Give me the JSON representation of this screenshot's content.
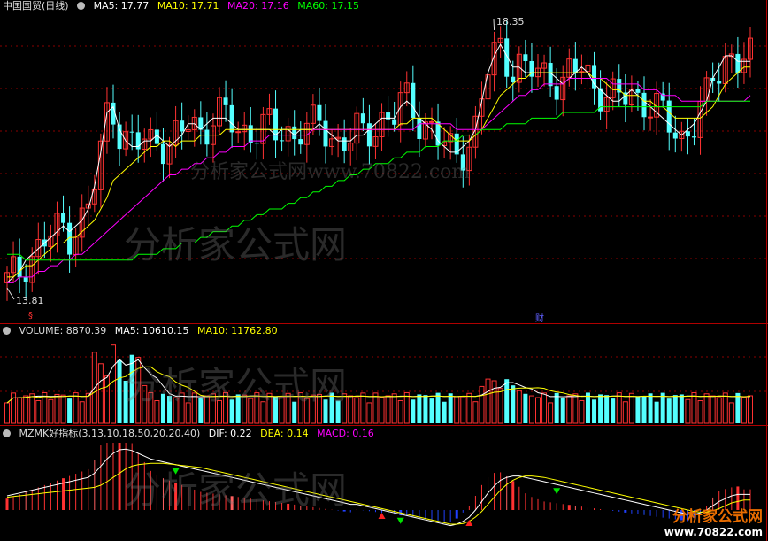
{
  "header": {
    "title": "中国国贸(日线)",
    "ma5": "MA5: 17.77",
    "ma10": "MA10: 17.71",
    "ma20": "MA20: 17.16",
    "ma60": "MA60: 17.15"
  },
  "volume_header": {
    "label": "VOLUME: 8870.39",
    "ma5": "MA5: 10610.15",
    "ma10": "MA10: 11762.80"
  },
  "indicator_header": {
    "label": "MZMK好指标(3,13,10,18,50,20,20,40)",
    "dif": "DIF: 0.22",
    "dea": "DEA: 0.14",
    "macd": "MACD: 0.16"
  },
  "annotations": {
    "high": "18.35",
    "low": "13.81",
    "caibadge": "财"
  },
  "watermark": {
    "main": "分析家公式网",
    "url": "分析家公式网www.70822.com"
  },
  "logo": {
    "title": "分析家公式网",
    "url": "www.70822.com"
  },
  "colors": {
    "up": "#ff3232",
    "down": "#54ffff",
    "ma5": "#ffffff",
    "ma10": "#ffff00",
    "ma20": "#ff00ff",
    "ma60": "#00ff00",
    "frame": "#b00000",
    "histogram_neg": "#2040ff"
  },
  "chart_data": [
    {
      "type": "candlestick",
      "panel": "price",
      "ylim": [
        13.5,
        18.6
      ],
      "series": [
        {
          "name": "MA5",
          "values": [
            13.9,
            14.0,
            14.1,
            14.3,
            14.4,
            14.5,
            14.6,
            14.7,
            14.8,
            14.9,
            14.8,
            14.9,
            15.0,
            15.2,
            15.6,
            16.2,
            16.9,
            17.0,
            16.6,
            16.4,
            16.3,
            16.3,
            16.4,
            16.4,
            16.5,
            16.4,
            16.3,
            16.4,
            16.5,
            16.7,
            16.7,
            16.6,
            16.7,
            16.8,
            16.8,
            16.8,
            16.7,
            16.6,
            16.6,
            16.6,
            16.6,
            16.6,
            16.6,
            16.5,
            16.6,
            16.6,
            16.5,
            16.6,
            16.6,
            16.6,
            16.7,
            16.6,
            16.5,
            16.4,
            16.4,
            16.4,
            16.5,
            16.5,
            16.6,
            16.7,
            16.8,
            16.8,
            16.8,
            17.0,
            17.1,
            17.0,
            16.8,
            16.7,
            16.6,
            16.4,
            16.3,
            16.2,
            16.2,
            16.3,
            16.4,
            16.6,
            17.1,
            17.6,
            17.9,
            18.1,
            17.9,
            17.7,
            17.7,
            17.6,
            17.6,
            17.6,
            17.6,
            17.6,
            17.5,
            17.4,
            17.5,
            17.6,
            17.7,
            17.6,
            17.4,
            17.3,
            17.2,
            17.1,
            17.1,
            17.2,
            17.3,
            17.2,
            17.1,
            17.0,
            16.9,
            16.8,
            16.7,
            16.6,
            16.5,
            16.6,
            16.7,
            16.9,
            17.1,
            17.5,
            17.7,
            17.9,
            17.9,
            17.8,
            17.8,
            17.8
          ]
        },
        {
          "name": "MA10",
          "values": [
            14.0,
            14.0,
            14.1,
            14.2,
            14.2,
            14.3,
            14.4,
            14.5,
            14.6,
            14.6,
            14.7,
            14.7,
            14.8,
            14.9,
            15.0,
            15.2,
            15.4,
            15.7,
            15.8,
            15.9,
            16.0,
            16.1,
            16.2,
            16.3,
            16.3,
            16.4,
            16.4,
            16.3,
            16.4,
            16.4,
            16.4,
            16.5,
            16.5,
            16.5,
            16.5,
            16.6,
            16.6,
            16.6,
            16.6,
            16.6,
            16.6,
            16.6,
            16.6,
            16.6,
            16.6,
            16.6,
            16.6,
            16.6,
            16.6,
            16.6,
            16.6,
            16.6,
            16.6,
            16.6,
            16.6,
            16.6,
            16.6,
            16.6,
            16.6,
            16.6,
            16.6,
            16.6,
            16.6,
            16.7,
            16.7,
            16.8,
            16.8,
            16.8,
            16.8,
            16.7,
            16.6,
            16.5,
            16.4,
            16.4,
            16.4,
            16.5,
            16.6,
            16.8,
            17.0,
            17.2,
            17.3,
            17.4,
            17.5,
            17.5,
            17.6,
            17.6,
            17.6,
            17.6,
            17.6,
            17.6,
            17.6,
            17.6,
            17.6,
            17.6,
            17.5,
            17.5,
            17.4,
            17.3,
            17.3,
            17.2,
            17.2,
            17.2,
            17.1,
            17.1,
            17.0,
            17.0,
            16.9,
            16.8,
            16.8,
            16.8,
            16.8,
            16.8,
            16.9,
            17.0,
            17.2,
            17.4,
            17.5,
            17.6,
            17.7,
            17.7
          ]
        },
        {
          "name": "MA20",
          "values": [
            13.9,
            13.9,
            14.0,
            14.0,
            14.0,
            14.1,
            14.1,
            14.2,
            14.2,
            14.3,
            14.3,
            14.4,
            14.4,
            14.5,
            14.6,
            14.7,
            14.8,
            14.9,
            15.0,
            15.1,
            15.2,
            15.3,
            15.4,
            15.5,
            15.6,
            15.7,
            15.8,
            15.8,
            15.9,
            15.9,
            16.0,
            16.0,
            16.1,
            16.1,
            16.2,
            16.2,
            16.3,
            16.3,
            16.3,
            16.4,
            16.4,
            16.4,
            16.5,
            16.5,
            16.5,
            16.5,
            16.5,
            16.5,
            16.5,
            16.6,
            16.6,
            16.6,
            16.6,
            16.6,
            16.6,
            16.6,
            16.6,
            16.6,
            16.6,
            16.6,
            16.6,
            16.6,
            16.6,
            16.6,
            16.6,
            16.6,
            16.7,
            16.7,
            16.7,
            16.7,
            16.7,
            16.7,
            16.6,
            16.6,
            16.6,
            16.6,
            16.6,
            16.7,
            16.8,
            16.9,
            17.0,
            17.1,
            17.2,
            17.2,
            17.3,
            17.3,
            17.4,
            17.4,
            17.4,
            17.4,
            17.5,
            17.5,
            17.5,
            17.5,
            17.5,
            17.5,
            17.5,
            17.4,
            17.4,
            17.4,
            17.4,
            17.4,
            17.3,
            17.3,
            17.3,
            17.2,
            17.2,
            17.2,
            17.1,
            17.1,
            17.1,
            17.1,
            17.1,
            17.1,
            17.1,
            17.1,
            17.1,
            17.1,
            17.1,
            17.2
          ]
        },
        {
          "name": "MA60",
          "values": [
            14.4,
            14.4,
            14.4,
            14.3,
            14.3,
            14.3,
            14.3,
            14.3,
            14.3,
            14.3,
            14.3,
            14.3,
            14.3,
            14.3,
            14.3,
            14.3,
            14.3,
            14.3,
            14.3,
            14.3,
            14.3,
            14.4,
            14.4,
            14.4,
            14.4,
            14.5,
            14.5,
            14.5,
            14.6,
            14.6,
            14.6,
            14.7,
            14.7,
            14.8,
            14.8,
            14.8,
            14.9,
            14.9,
            15.0,
            15.0,
            15.1,
            15.1,
            15.2,
            15.2,
            15.2,
            15.3,
            15.3,
            15.4,
            15.4,
            15.5,
            15.5,
            15.6,
            15.6,
            15.7,
            15.7,
            15.8,
            15.8,
            15.9,
            15.9,
            16.0,
            16.0,
            16.0,
            16.1,
            16.1,
            16.2,
            16.2,
            16.2,
            16.3,
            16.3,
            16.3,
            16.4,
            16.4,
            16.4,
            16.5,
            16.5,
            16.5,
            16.6,
            16.6,
            16.6,
            16.6,
            16.7,
            16.7,
            16.7,
            16.7,
            16.8,
            16.8,
            16.8,
            16.8,
            16.8,
            16.9,
            16.9,
            16.9,
            16.9,
            16.9,
            16.9,
            17.0,
            17.0,
            17.0,
            17.0,
            17.0,
            17.0,
            17.0,
            17.0,
            17.0,
            17.0,
            17.0,
            17.0,
            17.0,
            17.0,
            17.0,
            17.0,
            17.0,
            17.1,
            17.1,
            17.1,
            17.1,
            17.1,
            17.1,
            17.1,
            17.1
          ]
        }
      ]
    },
    {
      "type": "bar",
      "panel": "volume",
      "ylim": [
        0,
        50000
      ]
    },
    {
      "type": "bar",
      "panel": "indicator",
      "series": [
        {
          "name": "DIF",
          "values": [
            0.2,
            0.22,
            0.24,
            0.26,
            0.28,
            0.3,
            0.32,
            0.34,
            0.36,
            0.38,
            0.4,
            0.42,
            0.44,
            0.46,
            0.52,
            0.62,
            0.72,
            0.8,
            0.85,
            0.86,
            0.84,
            0.8,
            0.76,
            0.72,
            0.7,
            0.68,
            0.66,
            0.64,
            0.62,
            0.6,
            0.58,
            0.56,
            0.54,
            0.52,
            0.5,
            0.48,
            0.46,
            0.44,
            0.42,
            0.4,
            0.38,
            0.36,
            0.34,
            0.32,
            0.3,
            0.28,
            0.26,
            0.24,
            0.22,
            0.2,
            0.18,
            0.16,
            0.14,
            0.12,
            0.1,
            0.08,
            0.08,
            0.06,
            0.04,
            0.02,
            0.0,
            -0.02,
            -0.04,
            -0.06,
            -0.08,
            -0.1,
            -0.12,
            -0.14,
            -0.16,
            -0.18,
            -0.2,
            -0.22,
            -0.2,
            -0.16,
            -0.1,
            0.0,
            0.12,
            0.24,
            0.34,
            0.42,
            0.46,
            0.48,
            0.48,
            0.46,
            0.44,
            0.42,
            0.4,
            0.38,
            0.36,
            0.34,
            0.32,
            0.3,
            0.28,
            0.26,
            0.24,
            0.22,
            0.2,
            0.18,
            0.16,
            0.14,
            0.12,
            0.1,
            0.08,
            0.06,
            0.04,
            0.02,
            0.0,
            -0.02,
            -0.04,
            -0.06,
            -0.06,
            -0.04,
            0.0,
            0.06,
            0.12,
            0.16,
            0.2,
            0.22,
            0.22,
            0.22
          ]
        },
        {
          "name": "DEA",
          "values": [
            0.18,
            0.19,
            0.2,
            0.21,
            0.22,
            0.23,
            0.24,
            0.25,
            0.26,
            0.27,
            0.28,
            0.29,
            0.3,
            0.31,
            0.32,
            0.35,
            0.4,
            0.46,
            0.52,
            0.58,
            0.62,
            0.64,
            0.65,
            0.66,
            0.66,
            0.66,
            0.65,
            0.64,
            0.63,
            0.62,
            0.61,
            0.6,
            0.58,
            0.56,
            0.54,
            0.52,
            0.5,
            0.48,
            0.46,
            0.44,
            0.42,
            0.4,
            0.38,
            0.36,
            0.34,
            0.32,
            0.3,
            0.28,
            0.26,
            0.24,
            0.22,
            0.2,
            0.18,
            0.16,
            0.14,
            0.12,
            0.1,
            0.08,
            0.06,
            0.04,
            0.02,
            0.0,
            -0.02,
            -0.04,
            -0.06,
            -0.08,
            -0.1,
            -0.12,
            -0.14,
            -0.16,
            -0.18,
            -0.2,
            -0.2,
            -0.19,
            -0.16,
            -0.1,
            -0.02,
            0.08,
            0.18,
            0.28,
            0.36,
            0.42,
            0.46,
            0.48,
            0.48,
            0.47,
            0.46,
            0.44,
            0.42,
            0.4,
            0.38,
            0.36,
            0.34,
            0.32,
            0.3,
            0.28,
            0.26,
            0.24,
            0.22,
            0.2,
            0.18,
            0.16,
            0.14,
            0.12,
            0.1,
            0.08,
            0.06,
            0.04,
            0.02,
            0.0,
            -0.02,
            -0.03,
            -0.03,
            -0.01,
            0.02,
            0.06,
            0.1,
            0.12,
            0.14,
            0.14
          ]
        }
      ]
    }
  ]
}
